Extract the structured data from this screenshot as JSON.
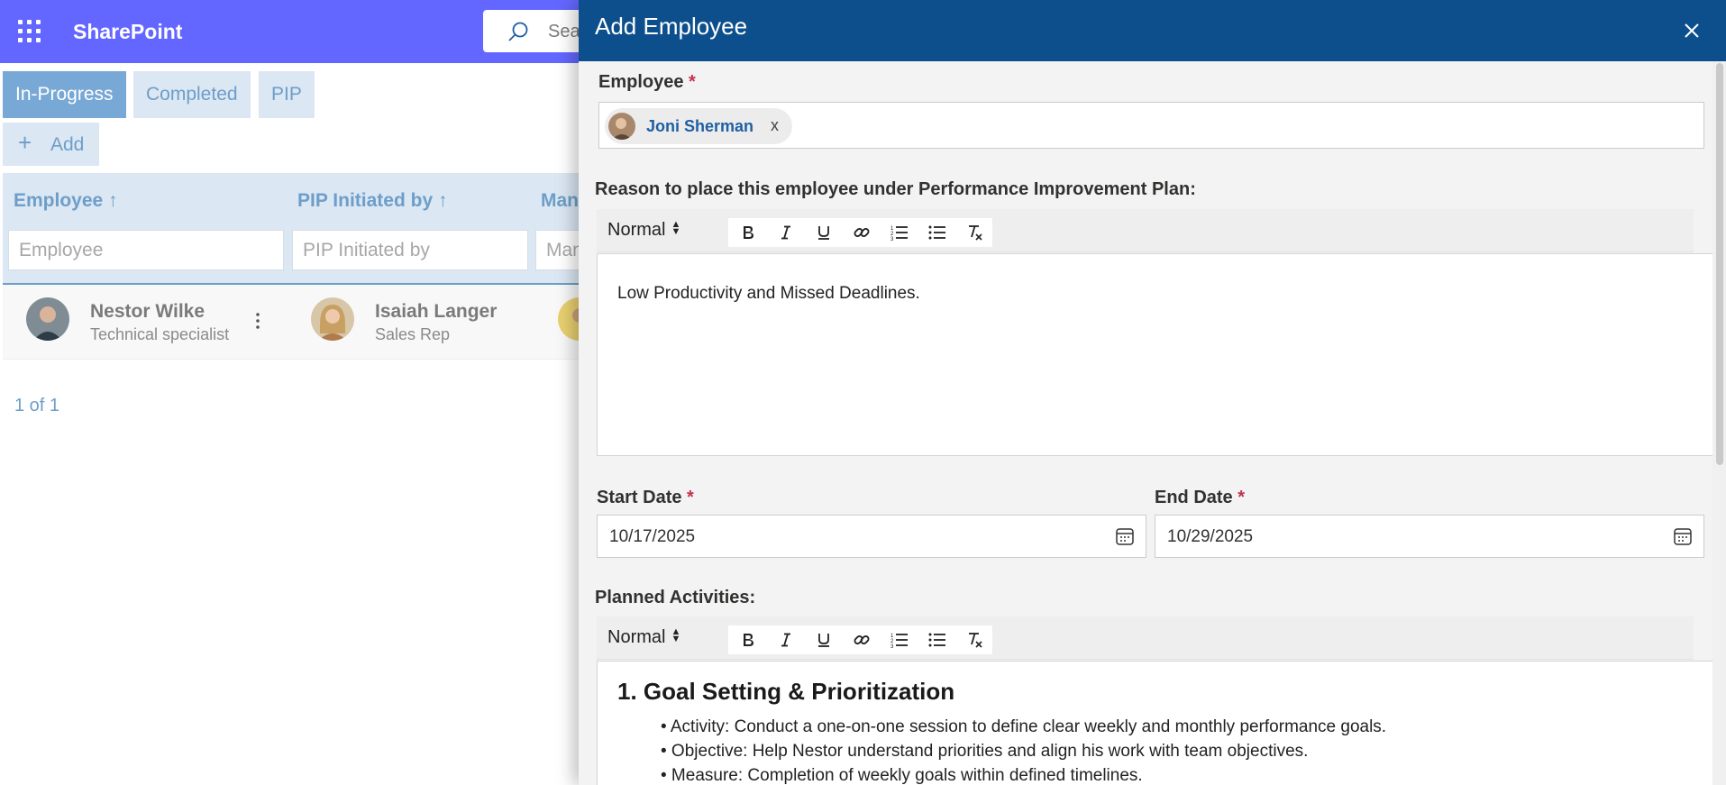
{
  "app": {
    "brand": "SharePoint",
    "search_placeholder": "Sea"
  },
  "tabs": [
    {
      "label": "In-Progress",
      "active": true
    },
    {
      "label": "Completed",
      "active": false
    },
    {
      "label": "PIP",
      "active": false
    }
  ],
  "add_button": {
    "label": "Add"
  },
  "grid": {
    "columns": [
      {
        "label": "Employee ↑",
        "filter_placeholder": "Employee"
      },
      {
        "label": "PIP Initiated by ↑",
        "filter_placeholder": "PIP Initiated by"
      },
      {
        "label": "Man",
        "filter_placeholder": "Man"
      }
    ],
    "rows": [
      {
        "employee": {
          "name": "Nestor Wilke",
          "role": "Technical specialist"
        },
        "initiated_by": {
          "name": "Isaiah Langer",
          "role": "Sales Rep"
        }
      }
    ],
    "pager": "1 of 1"
  },
  "panel": {
    "title": "Add Employee",
    "employee_label": "Employee",
    "required_mark": "*",
    "selected_employee": "Joni Sherman",
    "remove_chip": "x",
    "reason_label": "Reason to place this employee under Performance Improvement Plan:",
    "format_select": "Normal",
    "reason_text": "Low Productivity and Missed Deadlines.",
    "start_date_label": "Start Date",
    "start_date_value": "10/17/2025",
    "end_date_label": "End Date",
    "end_date_value": "10/29/2025",
    "activities_label": "Planned Activities:",
    "activities_heading": "1. Goal Setting & Prioritization",
    "activities_bullets": [
      "• Activity: Conduct a one-on-one session to define clear weekly and monthly performance goals.",
      "• Objective: Help Nestor understand priorities and align his work with team objectives.",
      "• Measure: Completion of weekly goals within defined timelines."
    ]
  },
  "colors": {
    "topbar": "#6467ff",
    "panel_header": "#0d4f8c",
    "tab_active": "#78a8d6",
    "tab_inactive": "#dbe7f3",
    "required": "#c4314b"
  }
}
